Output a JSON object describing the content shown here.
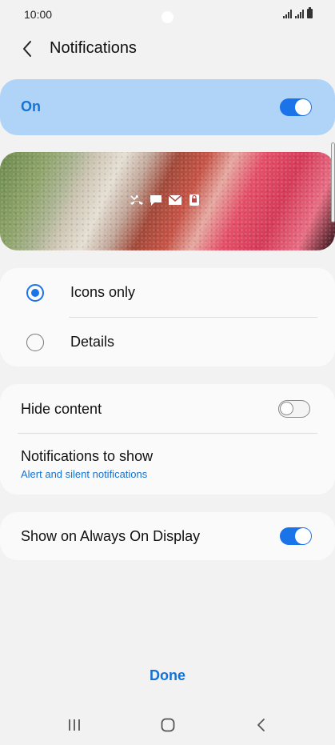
{
  "status_bar": {
    "time": "10:00"
  },
  "header": {
    "title": "Notifications",
    "back_icon": "chevron-left-icon"
  },
  "master": {
    "label": "On",
    "enabled": true
  },
  "preview": {
    "icons": [
      "missed-call-icon",
      "message-icon",
      "mail-icon",
      "lock-icon"
    ]
  },
  "style_options": [
    {
      "label": "Icons only",
      "selected": true
    },
    {
      "label": "Details",
      "selected": false
    }
  ],
  "settings": {
    "hide_content": {
      "label": "Hide content",
      "enabled": false
    },
    "notifications_to_show": {
      "label": "Notifications to show",
      "value": "Alert and silent notifications"
    },
    "always_on_display": {
      "label": "Show on Always On Display",
      "enabled": true
    }
  },
  "done_label": "Done",
  "nav": {
    "recents": "recents-icon",
    "home": "home-icon",
    "back": "back-icon"
  },
  "colors": {
    "accent": "#1a73e8",
    "accent_text": "#1473d4",
    "master_bg": "#b0d4f8",
    "background": "#f2f2f2"
  }
}
